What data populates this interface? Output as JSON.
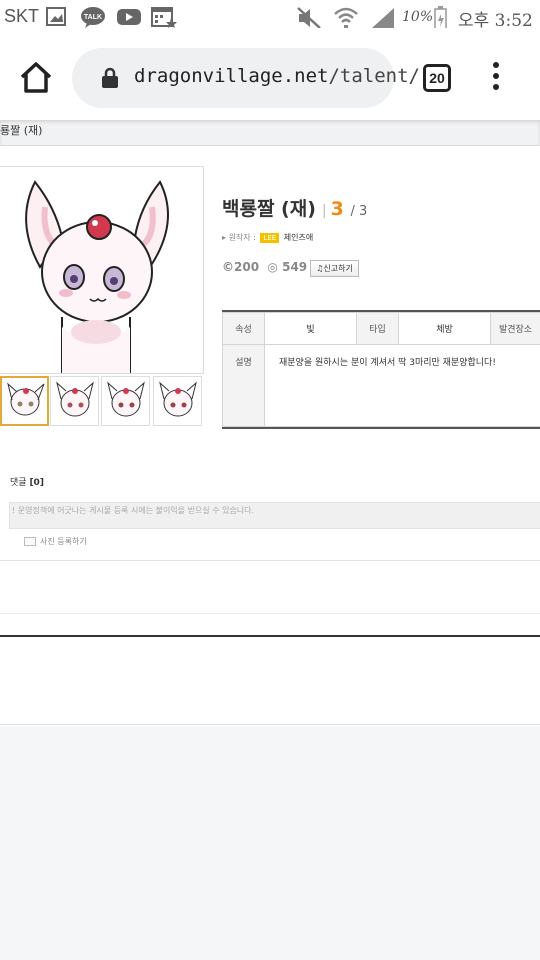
{
  "status_bar": {
    "carrier": "SKT",
    "battery": "10%",
    "time": "오후 3:52",
    "icons": [
      "image-icon",
      "kakaotalk-icon",
      "youtube-icon",
      "calendar-icon",
      "mute-icon",
      "wifi-icon",
      "signal-icon",
      "battery-icon"
    ]
  },
  "browser": {
    "url_host": "dragonvillage.net",
    "url_path": "/talent/",
    "tab_count": "20"
  },
  "page": {
    "breadcrumb": "룡짤 (재)",
    "title": "백룡짤 (재)",
    "count": "3",
    "count_total": "/ 3",
    "author_label": "원작자 :",
    "author_badge": "LEE",
    "author_name": "체인즈애",
    "comments_stat": "200",
    "views_stat": "549",
    "report_label": "신고하기",
    "table": {
      "h_attr": "속성",
      "v_attr": "빛",
      "h_type": "타입",
      "v_type": "체방",
      "h_found": "발견장소",
      "h_desc": "설명",
      "v_desc": "재분양을 원하시는 분이 계셔서 딱 3마리만 재분양합니다!"
    },
    "comments_label": "댓글",
    "comments_count": "[0]",
    "comment_notice": "! 운영정책에 어긋나는 게시물 등록 시에는 불이익을 받으실 수 있습니다.",
    "photo_link": "사진 등록하기"
  },
  "colors": {
    "accent": "#f08a16",
    "thumb_selected": "#e2a83a"
  }
}
